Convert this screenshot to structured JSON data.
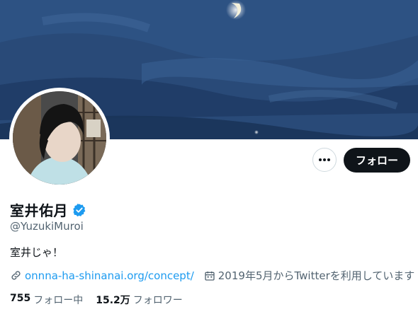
{
  "profile": {
    "display_name": "室井佑月",
    "handle": "@YuzukiMuroi",
    "bio": "室井じゃ！",
    "link": "onnna-ha-shinanai.org/concept/",
    "joined": "2019年5月からTwitterを利用しています",
    "following_count": "755",
    "following_label": "フォロー中",
    "followers_count": "15.2万",
    "followers_label": "フォロワー"
  },
  "actions": {
    "follow_label": "フォロー",
    "more_icon": "more-dots-icon"
  },
  "colors": {
    "accent": "#1d9bf0",
    "follow_bg": "#0f1419",
    "verified": "#1d9bf0"
  }
}
